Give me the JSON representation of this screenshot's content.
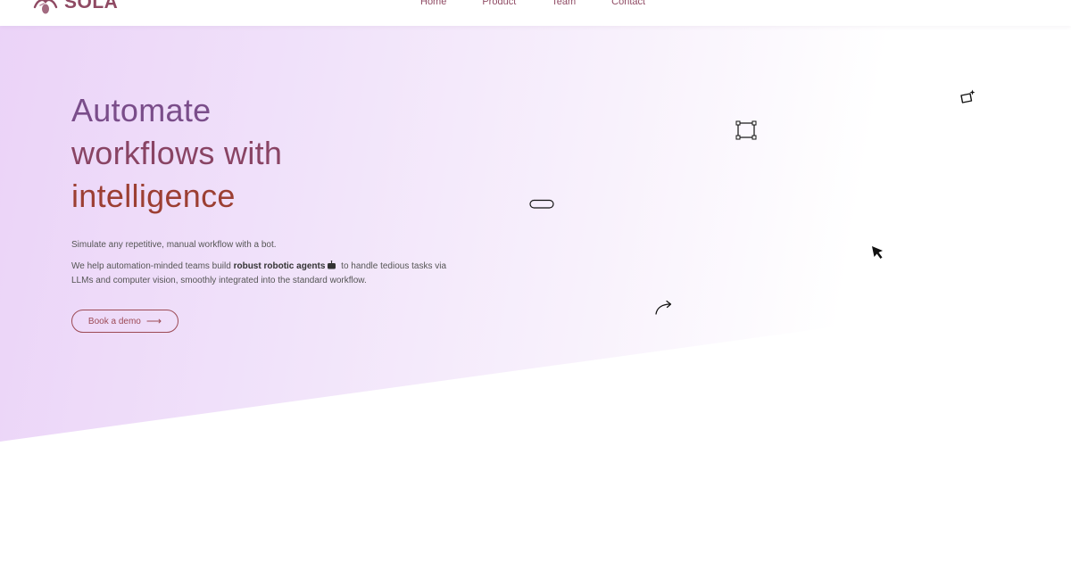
{
  "brand": {
    "name": "SOLA",
    "logo_icon": "sola-logo-icon"
  },
  "nav": {
    "links": [
      {
        "label": "Home"
      },
      {
        "label": "Product"
      },
      {
        "label": "Team"
      },
      {
        "label": "Contact"
      }
    ]
  },
  "hero": {
    "headline_lines": [
      "Automate",
      "workflows with",
      "intelligence"
    ],
    "subtitle": "Simulate any repetitive, manual workflow with a bot.",
    "description": {
      "prefix": "We help automation-minded teams build ",
      "emphasis": "robust robotic agents",
      "suffix": " to handle tedious tasks via LLMs and computer vision, smoothly integrated into the standard workflow."
    },
    "cta_label": "Book a demo",
    "cta_arrow": "⟶"
  },
  "decorations": [
    "sparkle-frame-icon",
    "frame-corners-icon",
    "pill-shape-icon",
    "cursor-pointer-icon",
    "curved-arrow-icon"
  ],
  "colors": {
    "brand": "#8f4a63",
    "headline_start": "#7a4d8a",
    "headline_mid": "#894464",
    "headline_end": "#9c3f33",
    "hero_gradient": "#ebd3f8",
    "cta_border": "#9c4a55"
  }
}
